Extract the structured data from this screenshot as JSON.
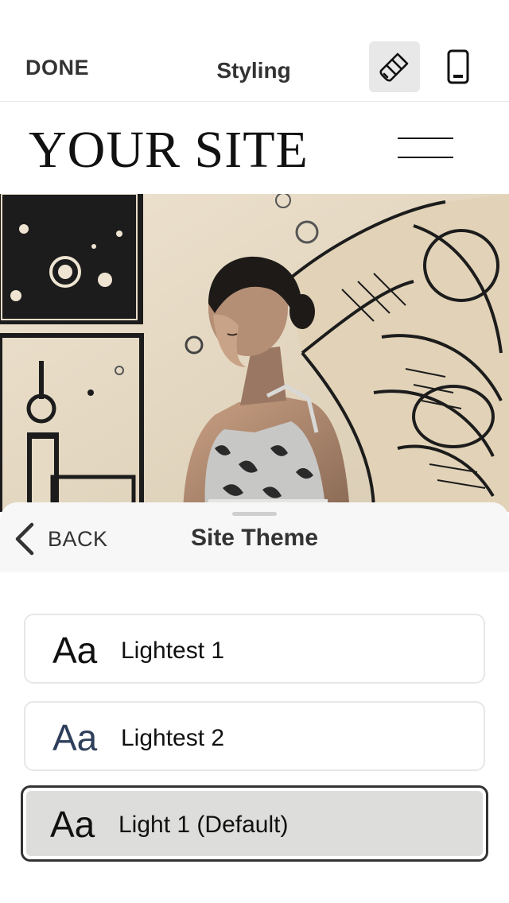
{
  "toolbar": {
    "done_label": "DONE",
    "title": "Styling",
    "brush_icon": "paintbrush-icon",
    "device_icon": "mobile-phone-icon"
  },
  "site": {
    "title": "YOUR SITE",
    "menu_icon": "hamburger-menu-icon"
  },
  "sheet": {
    "back_label": "BACK",
    "title": "Site Theme",
    "themes": [
      {
        "sample": "Aa",
        "name": "Lightest 1",
        "sample_color": "#111111",
        "selected": false
      },
      {
        "sample": "Aa",
        "name": "Lightest 2",
        "sample_color": "#2e3f5c",
        "selected": false
      },
      {
        "sample": "Aa",
        "name": "Light 1 (Default)",
        "sample_color": "#111111",
        "selected": true
      }
    ]
  }
}
